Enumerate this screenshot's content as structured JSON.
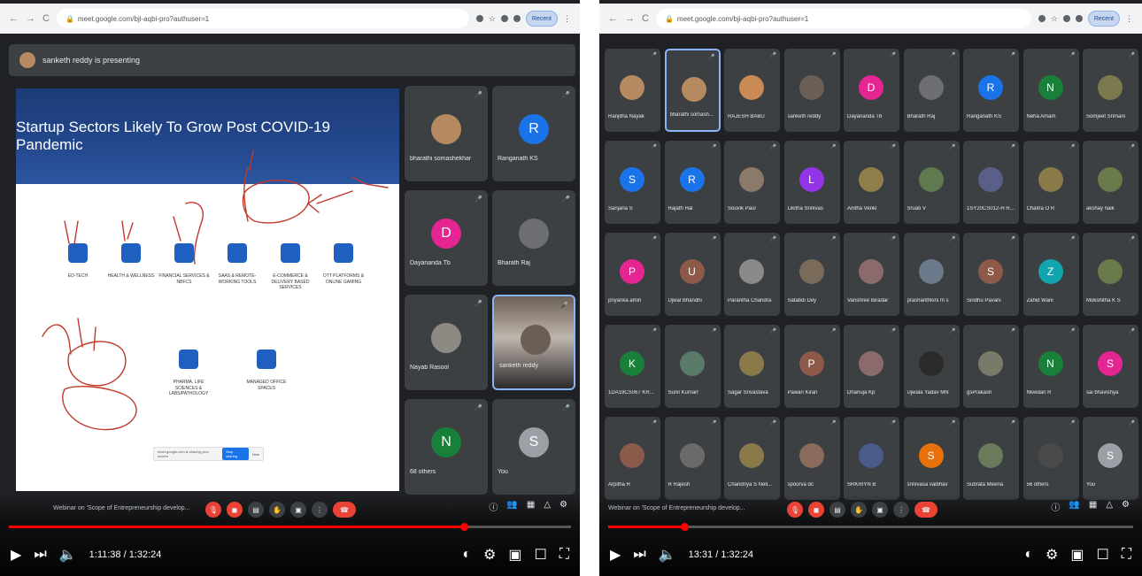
{
  "colors": {
    "meet_bg": "#202124",
    "tile_bg": "#3c4043",
    "youtube_red": "#ff0000",
    "slide_header": "#24488d",
    "active_border": "#8ab4f8"
  },
  "left": {
    "url": "meet.google.com/bji-aqbi-pro?authuser=1",
    "recent_label": "Recent",
    "presenter_banner": "sanketh reddy is presenting",
    "slide": {
      "title": "Startup Sectors Likely To Grow Post COVID-19 Pandemic",
      "sectors": [
        {
          "label": "ED-TECH"
        },
        {
          "label": "HEALTH & WELLNESS"
        },
        {
          "label": "FINANCIAL SERVICES & NBFCS"
        },
        {
          "label": "SAAS & REMOTE-WORKING TOOLS"
        },
        {
          "label": "E-COMMERCE & DELIVERY BASED SERVICES"
        },
        {
          "label": "OTT PLATFORMS & ONLINE GAMING"
        }
      ],
      "sectors_row2": [
        {
          "label": "PHARMA, LIFE SCIENCES & LABS/PATHOLOGY"
        },
        {
          "label": "MANAGED OFFICE SPACES"
        }
      ],
      "share_text": "meet.google.com is sharing your screen",
      "stop_sharing": "Stop sharing",
      "hide": "Hide"
    },
    "tiles": [
      {
        "name": "bharathi somashekhar",
        "initial": "",
        "color": "#b58a61"
      },
      {
        "name": "Ranganath KS",
        "initial": "R",
        "color": "#1a73e8"
      },
      {
        "name": "Dayananda Tb",
        "initial": "D",
        "color": "#e52592"
      },
      {
        "name": "Bharath Raj",
        "initial": "",
        "color": "#6d6f72"
      },
      {
        "name": "Nayab Rasool",
        "initial": "",
        "color": "#8d8a84"
      },
      {
        "name": "sanketh reddy",
        "initial": "",
        "color": "#6b5f55"
      },
      {
        "name": "68 others",
        "initial": "N",
        "color": "#188038"
      },
      {
        "name": "You",
        "initial": "S",
        "color": "#9aa0a6"
      }
    ],
    "video_title": "1:11:38 / 1:32:24",
    "video_label": "Webinar on 'Scope of Entrepreneurship develop...",
    "progress": 0.81,
    "time": "1:11:38 / 1:32:24"
  },
  "right": {
    "url": "meet.google.com/bji-aqbi-pro?authuser=1",
    "recent_label": "Recent",
    "tiles": [
      {
        "name": "Ranjitha Nayak",
        "initial": "",
        "color": "#b58a61"
      },
      {
        "name": "bharathi somash...",
        "initial": "",
        "color": "#b58a61"
      },
      {
        "name": "RAJESH BABU",
        "initial": "",
        "color": "#c98a53"
      },
      {
        "name": "sanketh reddy",
        "initial": "",
        "color": "#6b5f55"
      },
      {
        "name": "Dayananda Tb",
        "initial": "D",
        "color": "#e52592"
      },
      {
        "name": "Bharath Raj",
        "initial": "",
        "color": "#6d6f72"
      },
      {
        "name": "Ranganath KS",
        "initial": "R",
        "color": "#1a73e8"
      },
      {
        "name": "Neha Amam",
        "initial": "N",
        "color": "#188038"
      },
      {
        "name": "Somjeet Srimani",
        "initial": "",
        "color": "#7b7a4e"
      },
      {
        "name": "Sanjana S",
        "initial": "S",
        "color": "#1a73e8"
      },
      {
        "name": "Rajath Hal",
        "initial": "R",
        "color": "#1a73e8"
      },
      {
        "name": "Souvik Paul",
        "initial": "",
        "color": "#8a7a6a"
      },
      {
        "name": "Likitha Srinivas",
        "initial": "L",
        "color": "#9334e6"
      },
      {
        "name": "Anitha Venki",
        "initial": "",
        "color": "#8f7d4a"
      },
      {
        "name": "Sruati V",
        "initial": "",
        "color": "#5f7a4f"
      },
      {
        "name": "1SY20CS012-H R...",
        "initial": "",
        "color": "#5a5f8a"
      },
      {
        "name": "Chaitra O R",
        "initial": "",
        "color": "#8a7a4a"
      },
      {
        "name": "akshay naik",
        "initial": "",
        "color": "#6a7a4a"
      },
      {
        "name": "priyanka amin",
        "initial": "P",
        "color": "#e52592"
      },
      {
        "name": "Ujwal Bhandhi",
        "initial": "U",
        "color": "#8d5a4a"
      },
      {
        "name": "Parantha Chandra",
        "initial": "",
        "color": "#8a8a8a"
      },
      {
        "name": "Satabdi Dey",
        "initial": "",
        "color": "#7a6a5a"
      },
      {
        "name": "Varishree Biradar",
        "initial": "",
        "color": "#8a6a6a"
      },
      {
        "name": "prashanthkini m s",
        "initial": "",
        "color": "#6a7a8a"
      },
      {
        "name": "Sindhu Pavani",
        "initial": "S",
        "color": "#8d5a4a"
      },
      {
        "name": "Zahid Wani",
        "initial": "Z",
        "color": "#12a4af"
      },
      {
        "name": "Mokshitha K S",
        "initial": "",
        "color": "#6a7a4a"
      },
      {
        "name": "1DA19CS067 KR...",
        "initial": "K",
        "color": "#188038"
      },
      {
        "name": "Sunil Kumarr",
        "initial": "",
        "color": "#5a7a6a"
      },
      {
        "name": "Sagar Srivastava",
        "initial": "",
        "color": "#8a7a4a"
      },
      {
        "name": "Pawan Kiran",
        "initial": "P",
        "color": "#8d5a4a"
      },
      {
        "name": "Dhanuja Kp",
        "initial": "",
        "color": "#8a6a6a"
      },
      {
        "name": "Ujwala Yadav MN",
        "initial": "",
        "color": "#2a2a2a"
      },
      {
        "name": "gsPrakash",
        "initial": "",
        "color": "#7a7a6a"
      },
      {
        "name": "Nivedan R",
        "initial": "N",
        "color": "#188038"
      },
      {
        "name": "sai bhavishya",
        "initial": "S",
        "color": "#e52592"
      },
      {
        "name": "Arpitha R",
        "initial": "",
        "color": "#8a5a4a"
      },
      {
        "name": "R Rajesh",
        "initial": "",
        "color": "#6a6a6a"
      },
      {
        "name": "Chandriya S Nell...",
        "initial": "",
        "color": "#8a7a4a"
      },
      {
        "name": "spoorva dc",
        "initial": "",
        "color": "#8a6a5a"
      },
      {
        "name": "SRKRIYN B",
        "initial": "",
        "color": "#4a5a8a"
      },
      {
        "name": "srinivasa vaibhav",
        "initial": "S",
        "color": "#e8710a"
      },
      {
        "name": "Subrata Meena",
        "initial": "",
        "color": "#6a7a5a"
      },
      {
        "name": "56 others",
        "initial": "",
        "color": "#4a4a4a"
      },
      {
        "name": "You",
        "initial": "S",
        "color": "#9aa0a6"
      }
    ],
    "video_label": "Webinar on 'Scope of Entrepreneurship develop...",
    "progress": 0.145,
    "time": "13:31 / 1:32:24"
  }
}
